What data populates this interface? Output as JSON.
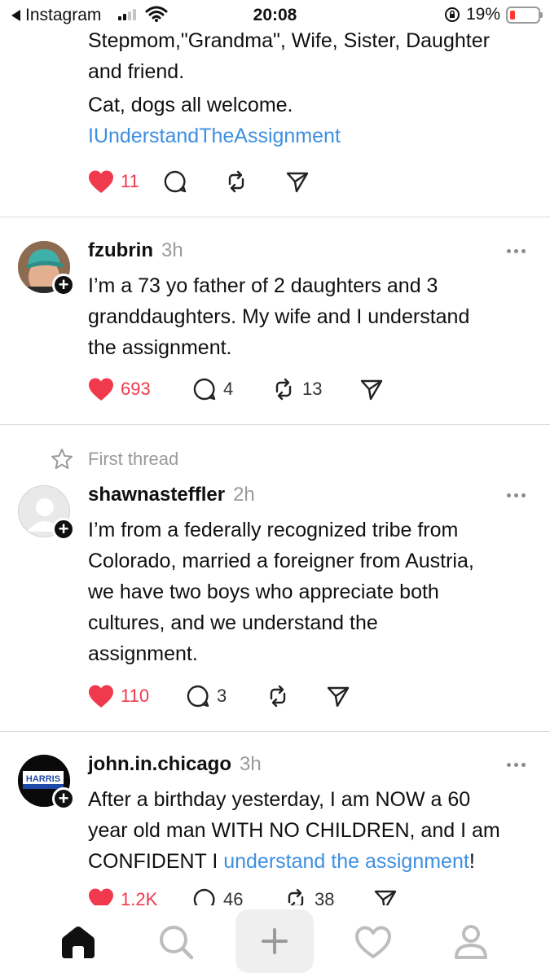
{
  "status_bar": {
    "back_app": "Instagram",
    "time": "20:08",
    "battery": "19%",
    "battery_level": 0.19,
    "signal_bars": 2
  },
  "colors": {
    "like": "#f0394d",
    "link": "#3d8fe0",
    "muted": "#9a9a9a",
    "text": "#101010"
  },
  "feed": {
    "partial_post": {
      "line1": "Stepmom,\"Grandma\", Wife, Sister, Daughter",
      "line2": "and friend.",
      "line3": " Cat, dogs all welcome.",
      "hashtag": "IUnderstandTheAssignment",
      "likes": "11"
    },
    "posts": [
      {
        "username": "fzubrin",
        "time": "3h",
        "lines": [
          "I’m a 73 yo father of 2 daughters and 3",
          "granddaughters. My wife and I understand",
          "the assignment."
        ],
        "likes": "693",
        "replies": "4",
        "reposts": "13"
      },
      {
        "label": "First thread",
        "username": "shawnasteffler",
        "time": "2h",
        "lines": [
          "I’m from a federally recognized tribe from",
          "Colorado, married a foreigner from Austria,",
          "we have two boys who appreciate both",
          "cultures, and we understand the",
          "assignment."
        ],
        "likes": "110",
        "replies": "3"
      },
      {
        "username": "john.in.chicago",
        "time": "3h",
        "avatar_text": "HARRIS",
        "lines": [
          "After a birthday yesterday, I am NOW a 60",
          "year old man WITH NO CHILDREN, and I am"
        ],
        "line3_prefix": "CONFIDENT I ",
        "line3_link": "understand the assignment",
        "line3_suffix": "!",
        "likes": "1.2K",
        "replies": "46",
        "reposts": "38"
      }
    ]
  },
  "bottom_nav": [
    "home-icon",
    "search-icon",
    "create-icon",
    "activity-icon",
    "profile-icon"
  ]
}
